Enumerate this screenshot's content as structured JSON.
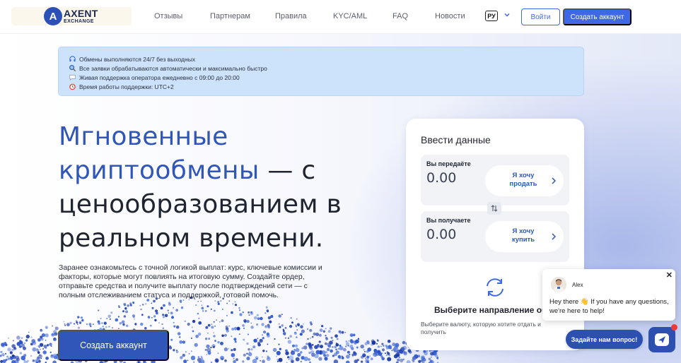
{
  "header": {
    "logo": {
      "mark": "A",
      "name": "AXENT",
      "sub": "EXCHANGE"
    },
    "nav": [
      {
        "label": "Отзывы"
      },
      {
        "label": "Партнерам"
      },
      {
        "label": "Правила"
      },
      {
        "label": "KYC/AML"
      },
      {
        "label": "FAQ"
      },
      {
        "label": "Новости"
      }
    ],
    "language": "РУ",
    "login_label": "Войти",
    "register_label": "Создать аккаунт"
  },
  "notice": {
    "lines": [
      {
        "icon": "headset-icon",
        "text": "Обмены выполняются 24/7 без выходных"
      },
      {
        "icon": "magnifier-icon",
        "text": "Все заявки обрабатываются автоматически и максимально быстро"
      },
      {
        "icon": "speech-bubble-icon",
        "text": "Живая поддержка оператора ежедневно с 09:00 до 20:00"
      },
      {
        "icon": "alarm-clock-icon",
        "text": "Время работы поддержки: UTC+2"
      }
    ]
  },
  "hero": {
    "headline_accent": "Мгновенные криптообмены",
    "headline_rest": " — с ценообразованием в реальном времени.",
    "description": "Заранее ознакомьтесь с точной логикой выплат: курс, ключевые комиссии и факторы, которые могут повлиять на итоговую сумму. Создайте ордер, отправьте средства и получите выплату после подтверждений сети — с полным отслеживанием статуса и поддержкой, готовой помочь.",
    "cta_label": "Создать аккаунт"
  },
  "exchange": {
    "title": "Ввести данные",
    "send": {
      "label": "Вы передаёте",
      "value": "0.00",
      "select_label": "Я хочу продать"
    },
    "receive": {
      "label": "Вы получаете",
      "value": "0.00",
      "select_label": "Я хочу купить"
    },
    "direction_title": "Выберите направление обмена",
    "direction_hint": "Выберите валюту, которую хотите отдать и получить"
  },
  "chat": {
    "agent_name": "Alex",
    "message": "Hey there 👋 If you have any questions, we're here to help!",
    "close": "✕",
    "question_label": "Задайте нам вопрос!"
  },
  "colors": {
    "accent": "#2f56b8",
    "button_blue": "#3f68e6",
    "notice_bg": "#cde3fb",
    "chat_blue": "#2c4fb0"
  }
}
